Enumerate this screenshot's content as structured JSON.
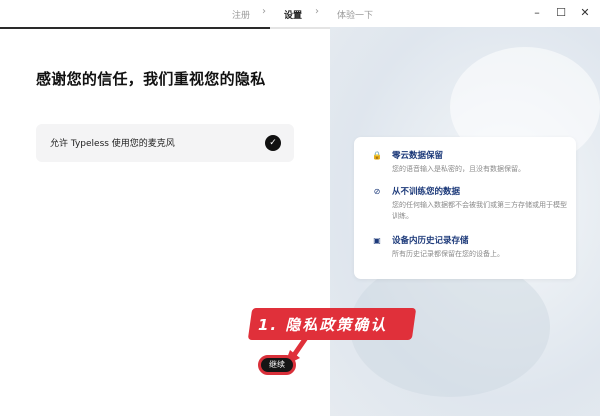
{
  "titlebar": {
    "steps": [
      "注册",
      "设置",
      "体验一下"
    ],
    "active_step": 1,
    "window_controls": [
      "minimize-icon",
      "maximize-icon",
      "close-icon"
    ]
  },
  "progress": {
    "fraction": 0.45
  },
  "left": {
    "heading": "感谢您的信任，我们重视您的隐私",
    "permission_label": "允许 Typeless 使用您的麦克风",
    "permission_checked": true,
    "continue_label": "继续"
  },
  "annotation": {
    "text": "1. 隐私政策确认",
    "color": "#e0303a"
  },
  "info": {
    "items": [
      {
        "icon": "lock-icon",
        "title": "零云数据保留",
        "desc": "您的语音输入是私密的，且没有数据保留。"
      },
      {
        "icon": "no-entry-icon",
        "title": "从不训练您的数据",
        "desc": "您的任何输入数据都不会被我们或第三方存储或用于模型训练。"
      },
      {
        "icon": "laptop-icon",
        "title": "设备内历史记录存储",
        "desc": "所有历史记录都保留在您的设备上。"
      }
    ]
  },
  "colors": {
    "accent": "#1d3a7a",
    "annotation": "#e0303a"
  }
}
